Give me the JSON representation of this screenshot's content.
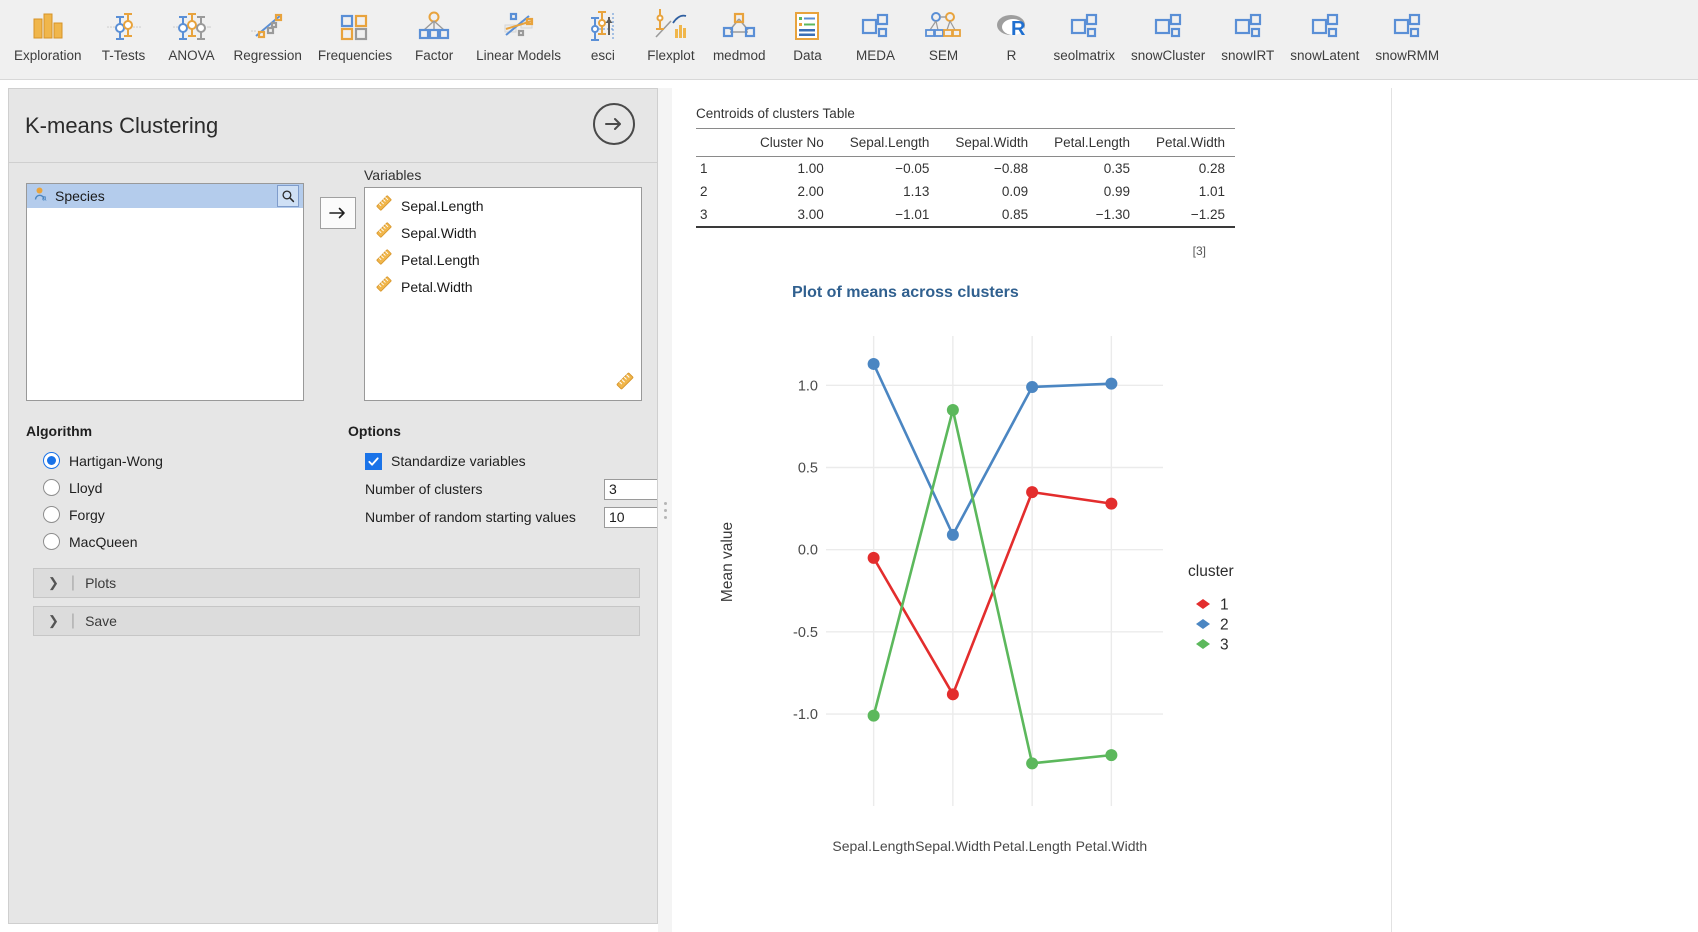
{
  "ribbon": {
    "items": [
      {
        "label": "Exploration",
        "icon": "bar-chart-icon"
      },
      {
        "label": "T-Tests",
        "icon": "t-test-icon"
      },
      {
        "label": "ANOVA",
        "icon": "anova-icon"
      },
      {
        "label": "Regression",
        "icon": "regression-icon"
      },
      {
        "label": "Frequencies",
        "icon": "frequencies-icon"
      },
      {
        "label": "Factor",
        "icon": "factor-icon"
      },
      {
        "label": "Linear Models",
        "icon": "linear-models-icon"
      },
      {
        "label": "esci",
        "icon": "esci-icon"
      },
      {
        "label": "Flexplot",
        "icon": "flexplot-icon"
      },
      {
        "label": "medmod",
        "icon": "medmod-icon"
      },
      {
        "label": "Data",
        "icon": "data-icon"
      },
      {
        "label": "MEDA",
        "icon": "module-icon"
      },
      {
        "label": "SEM",
        "icon": "sem-icon"
      },
      {
        "label": "R",
        "icon": "r-logo-icon"
      },
      {
        "label": "seolmatrix",
        "icon": "module-icon"
      },
      {
        "label": "snowCluster",
        "icon": "module-icon"
      },
      {
        "label": "snowIRT",
        "icon": "module-icon"
      },
      {
        "label": "snowLatent",
        "icon": "module-icon"
      },
      {
        "label": "snowRMM",
        "icon": "module-icon"
      }
    ]
  },
  "options_panel": {
    "title": "K-means Clustering",
    "run_icon": "arrow-right-circle-icon",
    "source_variables": [
      {
        "name": "Species",
        "icon": "nominal-text-icon",
        "selected": true
      }
    ],
    "search_icon": "search-icon",
    "move_icon": "arrow-right-icon",
    "variables_label": "Variables",
    "variables": [
      {
        "name": "Sepal.Length",
        "icon": "continuous-ruler-icon"
      },
      {
        "name": "Sepal.Width",
        "icon": "continuous-ruler-icon"
      },
      {
        "name": "Petal.Length",
        "icon": "continuous-ruler-icon"
      },
      {
        "name": "Petal.Width",
        "icon": "continuous-ruler-icon"
      }
    ],
    "algorithm": {
      "title": "Algorithm",
      "options": [
        {
          "label": "Hartigan-Wong",
          "selected": true
        },
        {
          "label": "Lloyd",
          "selected": false
        },
        {
          "label": "Forgy",
          "selected": false
        },
        {
          "label": "MacQueen",
          "selected": false
        }
      ]
    },
    "options_group": {
      "title": "Options",
      "standardize_label": "Standardize variables",
      "standardize_checked": true,
      "clusters_label": "Number of clusters",
      "clusters_value": "3",
      "starts_label": "Number of random starting values",
      "starts_value": "10"
    },
    "collapsibles": [
      {
        "label": "Plots",
        "chevron": "chevron-right-icon"
      },
      {
        "label": "Save",
        "chevron": "chevron-right-icon"
      }
    ]
  },
  "results": {
    "table": {
      "caption": "Centroids of clusters Table",
      "columns": [
        "",
        "Cluster No",
        "Sepal.Length",
        "Sepal.Width",
        "Petal.Length",
        "Petal.Width"
      ],
      "rows": [
        [
          "1",
          "1.00",
          "−0.05",
          "−0.88",
          "0.35",
          "0.28"
        ],
        [
          "2",
          "2.00",
          "1.13",
          "0.09",
          "0.99",
          "1.01"
        ],
        [
          "3",
          "3.00",
          "−1.01",
          "0.85",
          "−1.30",
          "−1.25"
        ]
      ],
      "note": "[3]"
    },
    "plot_title": "Plot of means across clusters"
  },
  "chart_data": {
    "type": "line",
    "title": "Plot of means across clusters",
    "xlabel": "",
    "ylabel": "Mean value",
    "categories": [
      "Sepal.Length",
      "Sepal.Width",
      "Petal.Length",
      "Petal.Width"
    ],
    "ylim": [
      -1.45,
      1.3
    ],
    "yticks": [
      -1.0,
      -0.5,
      0.0,
      0.5,
      1.0
    ],
    "ytick_labels": [
      "-1.0",
      "-0.5",
      "0.0",
      "0.5",
      "1.0"
    ],
    "grid": true,
    "legend_title": "cluster",
    "legend_position": "right",
    "series": [
      {
        "name": "1",
        "color": "#e32d2d",
        "values": [
          -0.05,
          -0.88,
          0.35,
          0.28
        ]
      },
      {
        "name": "2",
        "color": "#4b86c2",
        "values": [
          1.13,
          0.09,
          0.99,
          1.01
        ]
      },
      {
        "name": "3",
        "color": "#5cb85c",
        "values": [
          -1.01,
          0.85,
          -1.3,
          -1.25
        ]
      }
    ]
  }
}
